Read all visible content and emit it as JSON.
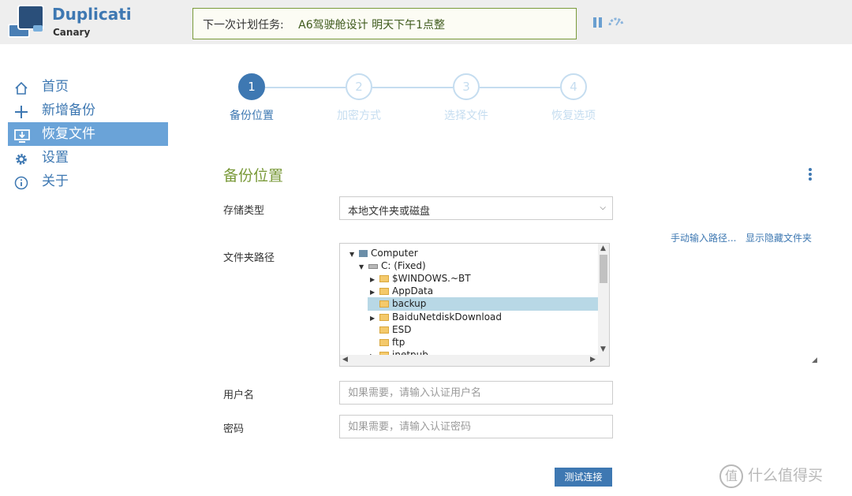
{
  "header": {
    "app_title": "Duplicati",
    "app_subtitle": "Canary",
    "schedule_label": "下一次计划任务:",
    "schedule_value": "A6驾驶舱设计 明天下午1点整"
  },
  "sidebar": {
    "items": [
      {
        "label": "首页",
        "icon": "home-icon"
      },
      {
        "label": "新增备份",
        "icon": "plus-icon"
      },
      {
        "label": "恢复文件",
        "icon": "restore-icon",
        "active": true
      },
      {
        "label": "设置",
        "icon": "gear-icon"
      },
      {
        "label": "关于",
        "icon": "info-icon"
      }
    ]
  },
  "stepper": {
    "steps": [
      {
        "num": "1",
        "label": "备份位置"
      },
      {
        "num": "2",
        "label": "加密方式"
      },
      {
        "num": "3",
        "label": "选择文件"
      },
      {
        "num": "4",
        "label": "恢复选项"
      }
    ]
  },
  "form": {
    "title": "备份位置",
    "storage_type_label": "存储类型",
    "storage_type_value": "本地文件夹或磁盘",
    "folder_path_label": "文件夹路径",
    "manual_path_link": "手动输入路径...",
    "show_hidden_link": "显示隐藏文件夹",
    "username_label": "用户名",
    "username_placeholder": "如果需要，请输入认证用户名",
    "password_label": "密码",
    "password_placeholder": "如果需要，请输入认证密码",
    "test_button": "测试连接"
  },
  "tree": {
    "computer": "Computer",
    "drive": "C: (Fixed)",
    "folders": [
      "$WINDOWS.~BT",
      "AppData",
      "backup",
      "BaiduNetdiskDownload",
      "ESD",
      "ftp",
      "inetpub"
    ],
    "selected": "backup"
  },
  "watermark": {
    "text": "什么值得买",
    "mark": "值"
  },
  "colors": {
    "accent": "#3e78b2",
    "green": "#7a9a3a",
    "active_nav": "#6aa3d8",
    "selection": "#b8d8e6"
  }
}
